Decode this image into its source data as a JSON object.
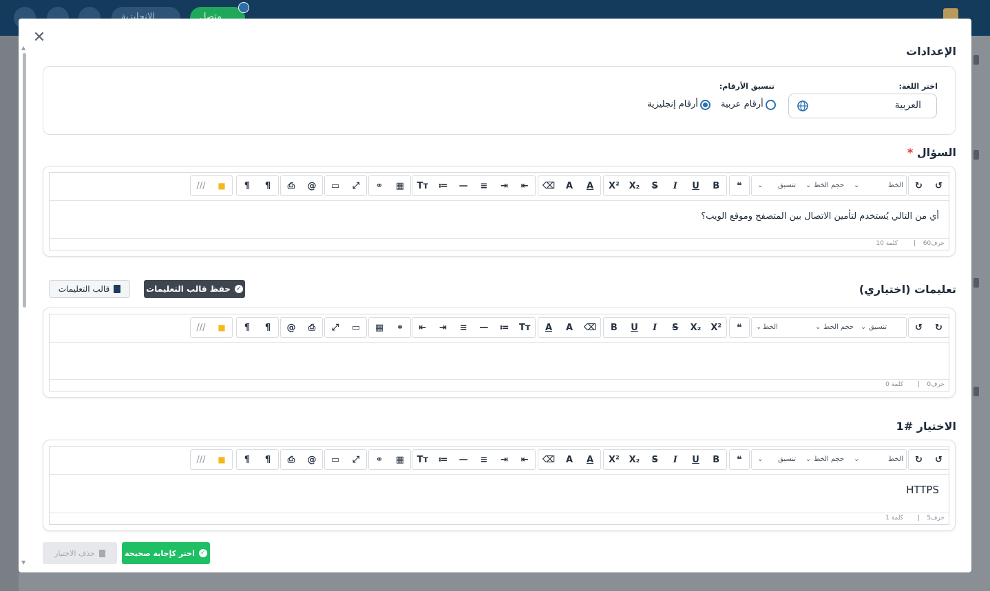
{
  "topbar": {
    "language_pill": "الإنجليزية",
    "online_pill": "متصل"
  },
  "modal": {
    "settings_title": "الإعدادات",
    "language_label": "اختر اللغة:",
    "language_value": "العربية",
    "numbers_label": "تنسيق الأرقام:",
    "radio_arabic": "أرقام عربية",
    "radio_english": "أرقام إنجليزية",
    "question_title": "السؤال",
    "question_text": "أي من التالي يُستخدم لتأمين الاتصال بين المتصفح وموقع الويب؟",
    "question_status_chars": "حرف60",
    "question_status_words": "كلمة 10",
    "instructions_title": "تعليمات (اختياري)",
    "save_template_btn": "حفظ قالب التعليمات",
    "template_btn": "قالب التعليمات",
    "instructions_status_chars": "حرف0",
    "instructions_status_words": "كلمة 0",
    "choice_title": "الاختيار #1",
    "choice_text": "HTTPS",
    "choice_status_chars": "حرف5",
    "choice_status_words": "كلمة 1",
    "mark_correct_btn": "اختر كإجابة صحيحة",
    "delete_choice_btn": "حذف الاختيار"
  },
  "toolbar_labels": {
    "font": "الخط",
    "font_size": "حجم الخط",
    "format": "تنسيق",
    "separator": "|"
  },
  "colors": {
    "topbar": "#143a5c",
    "accent_green": "#1fbf63",
    "dark_button": "#3f4650",
    "radio_blue": "#2a6fb0"
  }
}
